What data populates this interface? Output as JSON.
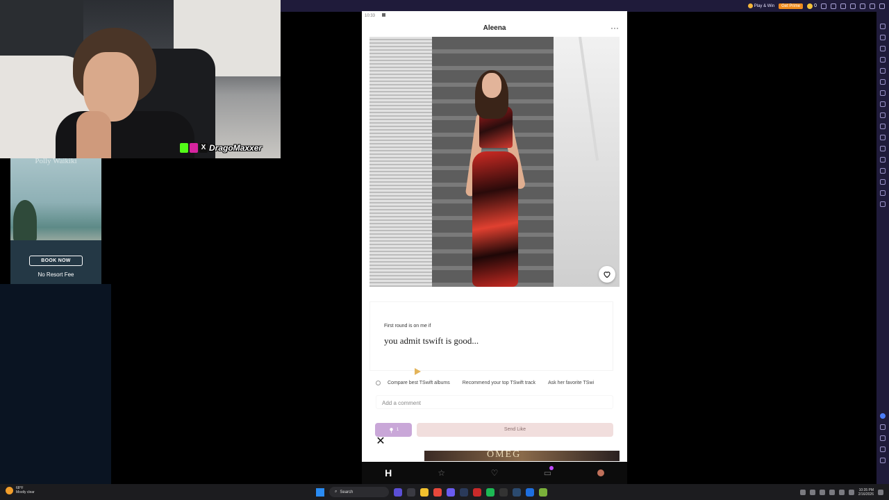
{
  "emulator": {
    "top_right": {
      "play_win": "Play & Win",
      "get_prime": "Get Prime",
      "coins": "0"
    }
  },
  "webcam": {
    "handle": "DragoMaxxer"
  },
  "ad": {
    "brand": "Polly Waikiki",
    "cta": "BOOK NOW",
    "subtext": "No Resort Fee"
  },
  "phone": {
    "status_time": "10:33",
    "profile_name": "Aleena",
    "more_label": "···",
    "prompt": {
      "question": "First round is on me if",
      "answer": "you admit tswift is good..."
    },
    "suggestions": [
      "Compare best TSwift albums",
      "Recommend your top TSwift track",
      "Ask her favorite TSwi"
    ],
    "comment_placeholder": "Add a comment",
    "rose_count": "1",
    "send_like_label": "Send Like",
    "next_photo_sign": "OMEG",
    "nav_home": "H",
    "nav_icons": [
      "home-icon",
      "standouts-icon",
      "likes-icon",
      "messages-icon",
      "profile-icon"
    ]
  },
  "taskbar": {
    "weather_temp": "68°F",
    "weather_desc": "Mostly clear",
    "search_label": "Search",
    "time": "10:35 PM",
    "date": "2/16/2026"
  },
  "colors": {
    "emulator_bar": "#1f1b3a",
    "rose_button": "#c9a7d8",
    "send_like": "#f1dedd",
    "kick_green": "#53fc18"
  }
}
